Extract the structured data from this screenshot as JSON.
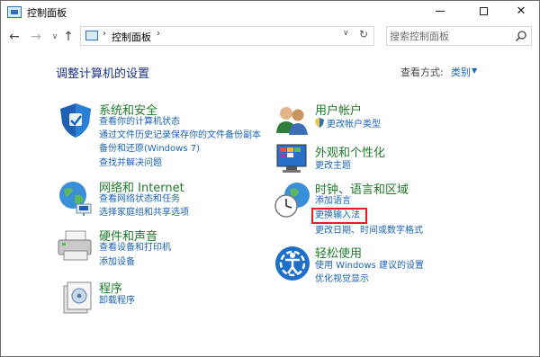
{
  "window": {
    "title": "控制面板"
  },
  "address_bar": {
    "path": "控制面板",
    "search_placeholder": "搜索控制面板"
  },
  "heading": "调整计算机的设置",
  "view": {
    "label": "查看方式:",
    "value": "类别"
  },
  "categories": {
    "system_security": {
      "title": "系统和安全",
      "links": [
        "查看你的计算机状态",
        "通过文件历史记录保存你的文件备份副本",
        "备份和还原(Windows 7)",
        "查找并解决问题"
      ]
    },
    "network": {
      "title": "网络和 Internet",
      "links": [
        "查看网络状态和任务",
        "选择家庭组和共享选项"
      ]
    },
    "hardware": {
      "title": "硬件和声音",
      "links": [
        "查看设备和打印机",
        "添加设备"
      ]
    },
    "programs": {
      "title": "程序",
      "links": [
        "卸载程序"
      ]
    },
    "user_accounts": {
      "title": "用户帐户",
      "links": [
        "更改帐户类型"
      ]
    },
    "appearance": {
      "title": "外观和个性化",
      "links": [
        "更改主题"
      ]
    },
    "clock_region": {
      "title": "时钟、语言和区域",
      "links": [
        "添加语言",
        "更换输入法",
        "更改日期、时间或数字格式"
      ]
    },
    "ease_of_access": {
      "title": "轻松使用",
      "links": [
        "使用 Windows 建议的设置",
        "优化视觉显示"
      ]
    }
  },
  "icons": {
    "system_security": "shield-icon",
    "network": "globe-network-icon",
    "hardware": "printer-icon",
    "programs": "programs-icon",
    "user_accounts": "users-icon",
    "appearance": "monitor-palette-icon",
    "clock_region": "clock-globe-icon",
    "ease_of_access": "ease-of-access-icon"
  },
  "colors": {
    "link": "#1a62b7",
    "category_title": "#1e7a2b",
    "heading": "#1e3287",
    "highlight": "#e21f26"
  }
}
